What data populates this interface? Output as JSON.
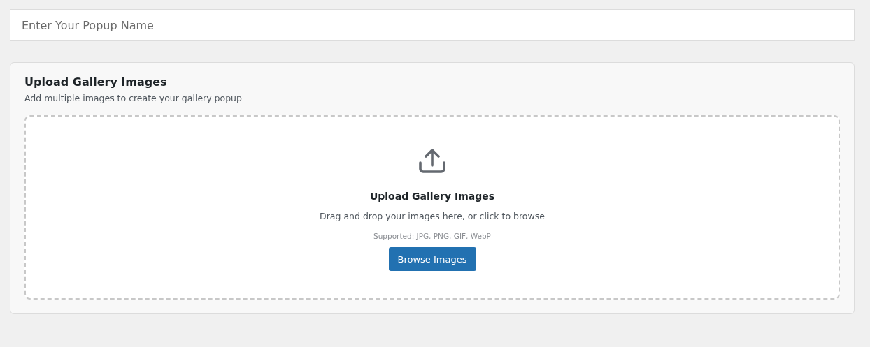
{
  "popup_name": {
    "placeholder": "Enter Your Popup Name"
  },
  "gallery": {
    "title": "Upload Gallery Images",
    "subtitle": "Add multiple images to create your gallery popup",
    "dropzone": {
      "title": "Upload Gallery Images",
      "hint": "Drag and drop your images here, or click to browse",
      "supported": "Supported: JPG, PNG, GIF, WebP",
      "button": "Browse Images"
    }
  }
}
